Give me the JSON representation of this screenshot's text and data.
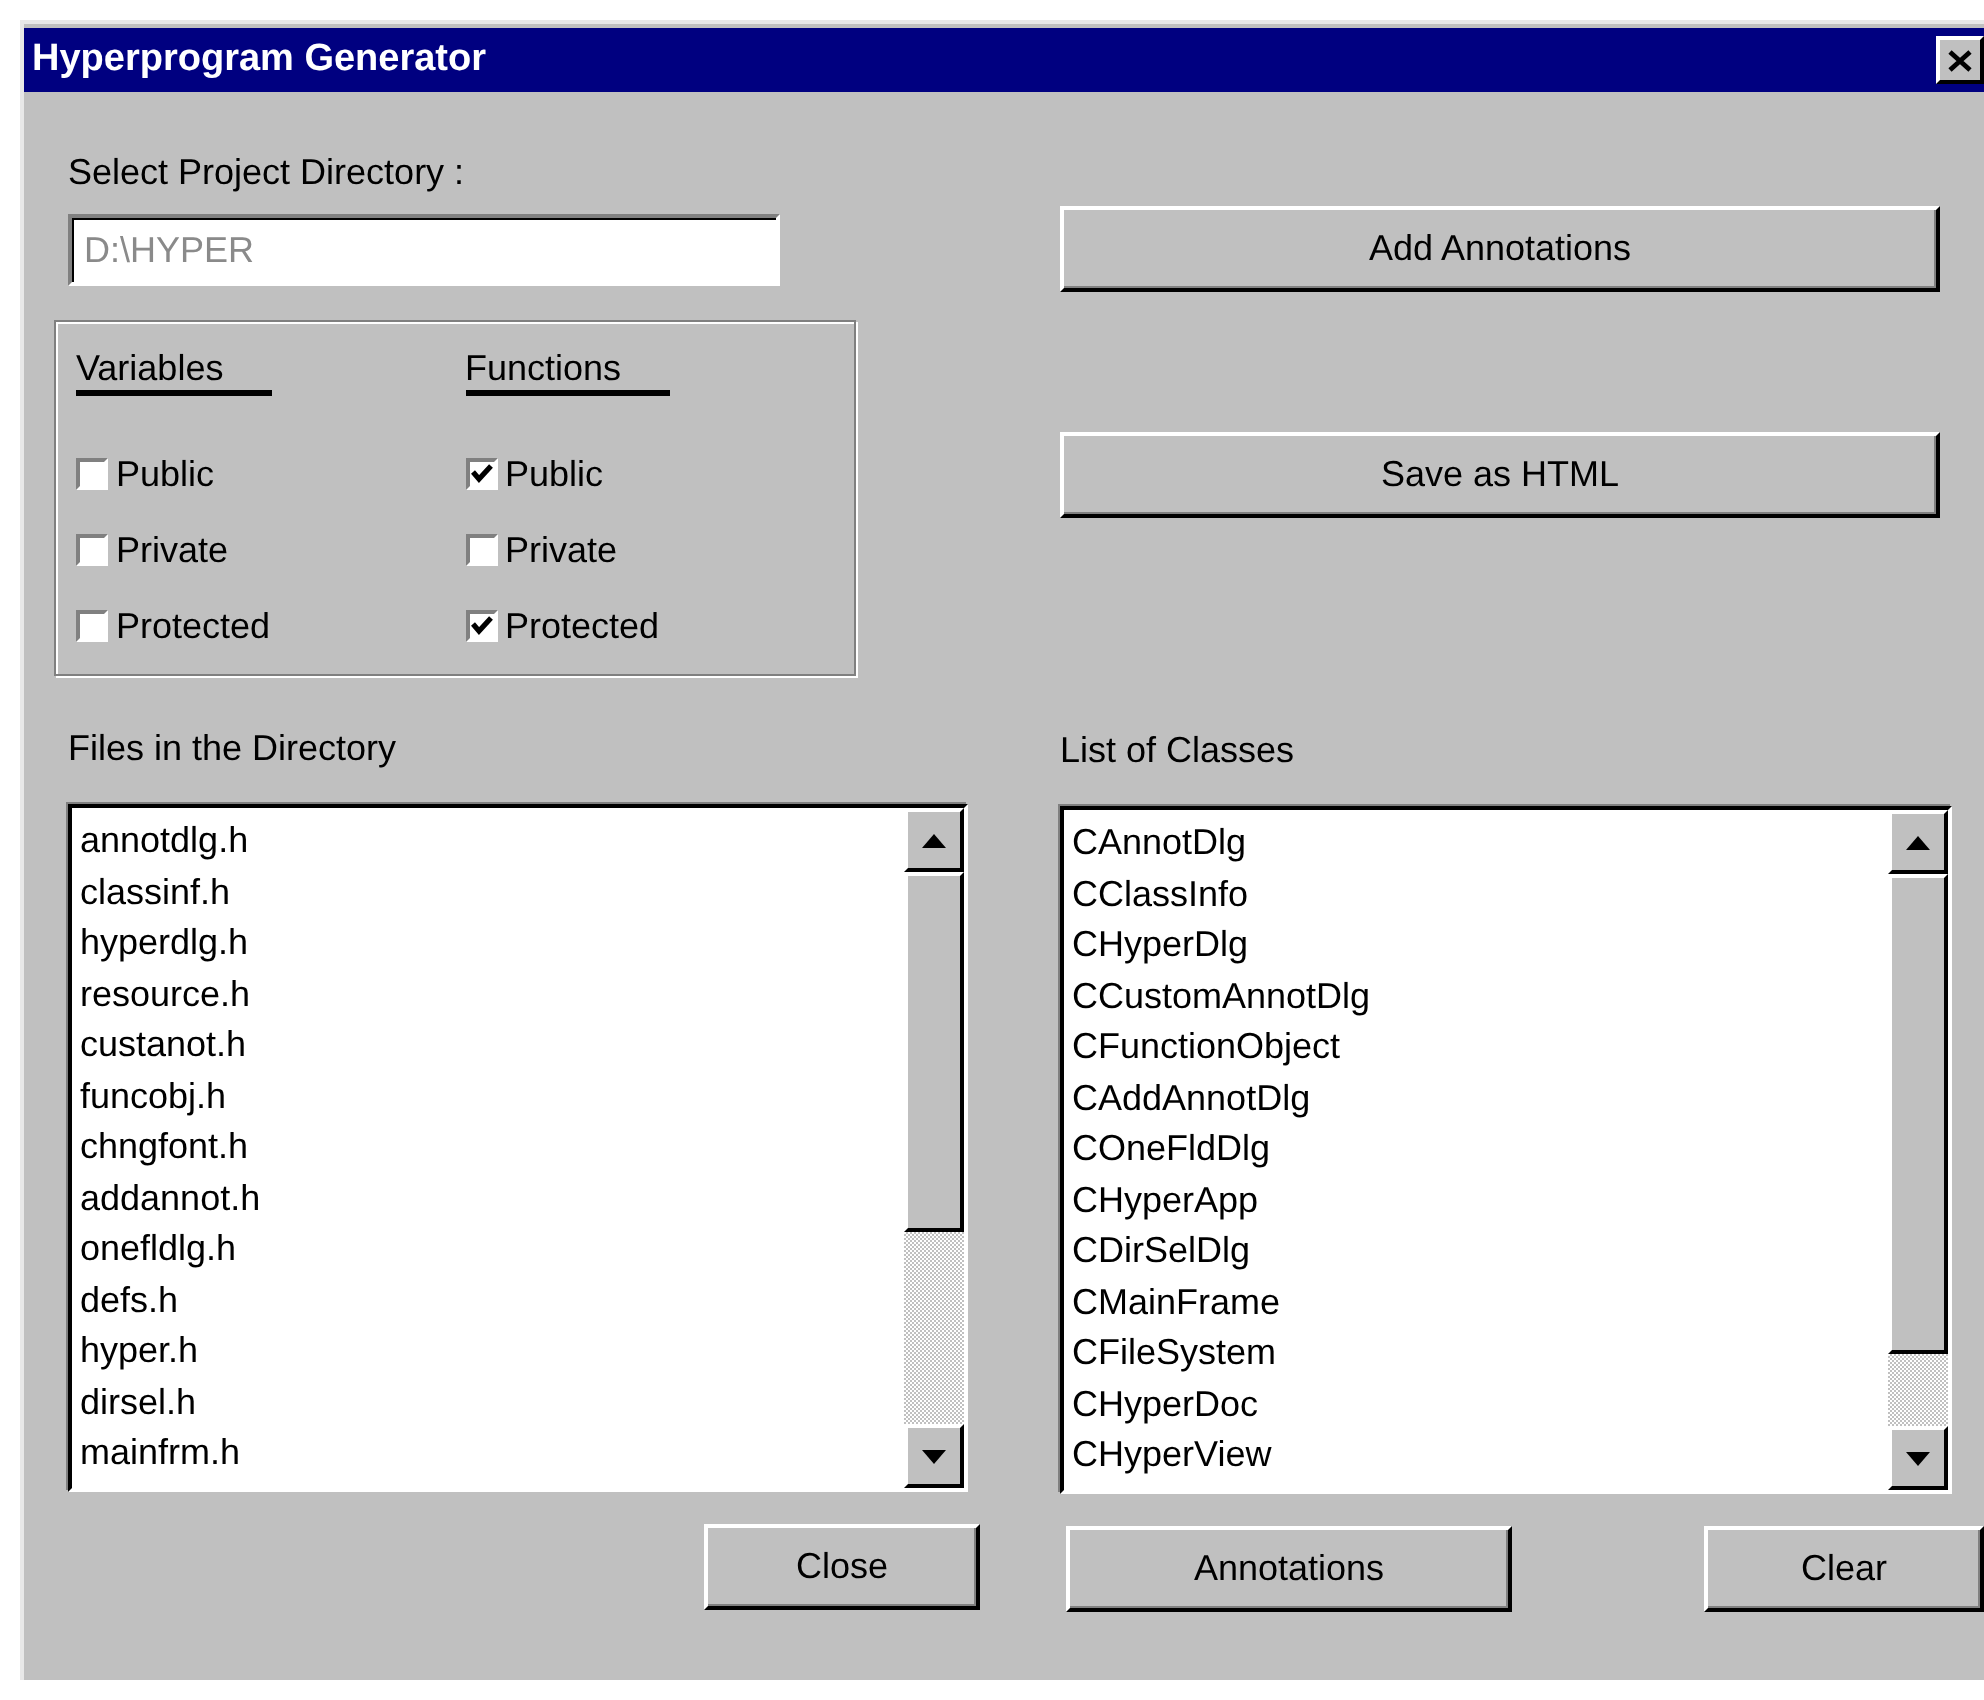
{
  "window": {
    "title": "Hyperprogram Generator"
  },
  "directory": {
    "label": "Select Project Directory :",
    "value": "D:\\HYPER",
    "disabled": true
  },
  "groups": [
    {
      "heading": "Variables",
      "options": [
        {
          "label": "Public",
          "checked": false
        },
        {
          "label": "Private",
          "checked": false
        },
        {
          "label": "Protected",
          "checked": false
        }
      ]
    },
    {
      "heading": "Functions",
      "options": [
        {
          "label": "Public",
          "checked": true
        },
        {
          "label": "Private",
          "checked": false
        },
        {
          "label": "Protected",
          "checked": true
        }
      ]
    }
  ],
  "actions": [
    "Add Annotations",
    "Save as HTML"
  ],
  "files": {
    "label": "Files in the Directory",
    "items": [
      "annotdlg.h",
      "classinf.h",
      "hyperdlg.h",
      "resource.h",
      "custanot.h",
      "funcobj.h",
      "chngfont.h",
      "addannot.h",
      "onefldlg.h",
      "defs.h",
      "hyper.h",
      "dirsel.h",
      "mainfrm.h"
    ],
    "buttons": [
      "Close"
    ]
  },
  "classes": {
    "label": "List of Classes",
    "items": [
      "CAnnotDlg",
      "CClassInfo",
      "CHyperDlg",
      "CCustomAnnotDlg",
      "CFunctionObject",
      "CAddAnnotDlg",
      "COneFldDlg",
      "CHyperApp",
      "CDirSelDlg",
      "CMainFrame",
      "CFileSystem",
      "CHyperDoc",
      "CHyperView"
    ],
    "buttons": [
      "Annotations",
      "Clear"
    ]
  }
}
